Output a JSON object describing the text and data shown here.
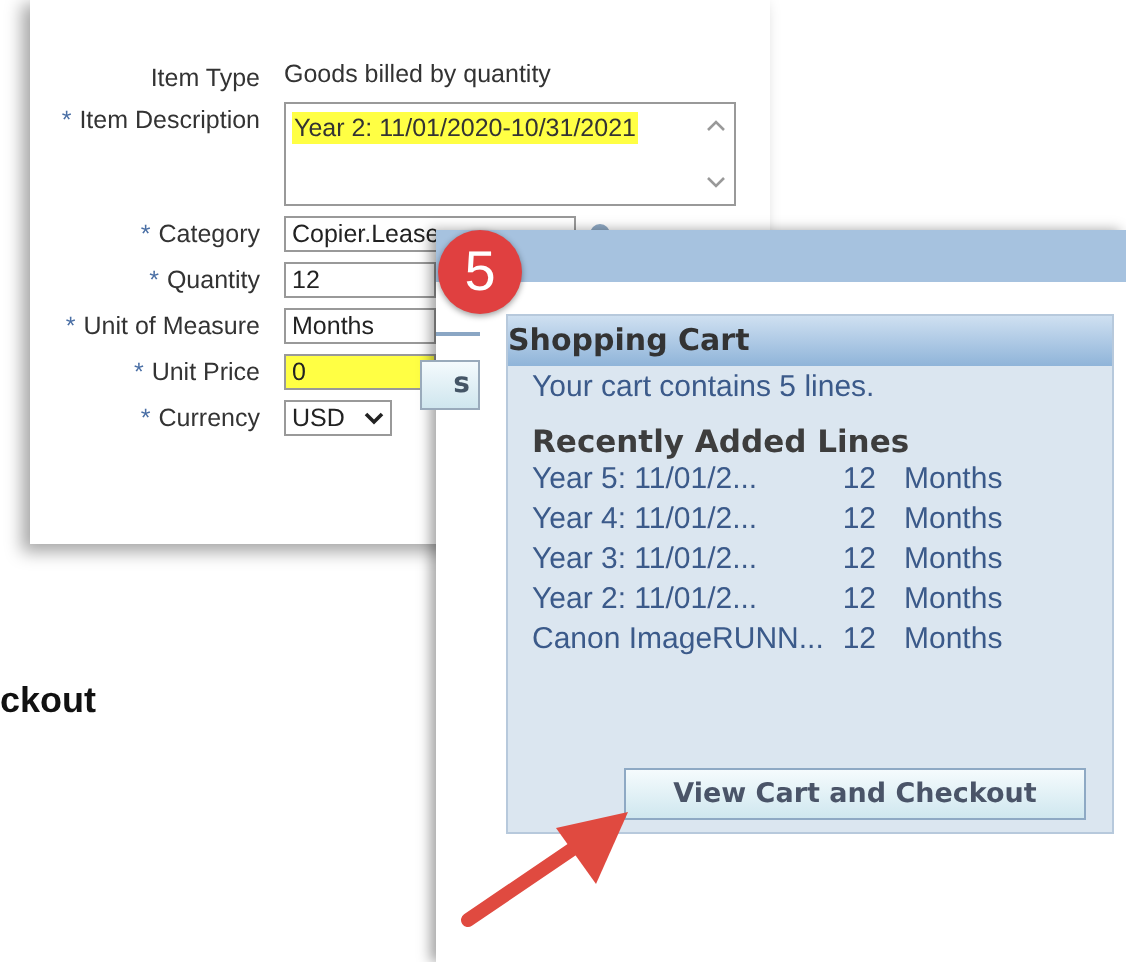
{
  "form": {
    "fields": [
      {
        "kind": "text",
        "label": "Item Type",
        "value": "Goods billed by quantity"
      },
      {
        "kind": "textarea",
        "mark": "*",
        "label": "Item Description",
        "value": "Year 2: 11/01/2020-10/31/2021",
        "highlighted": true
      },
      {
        "kind": "lookup",
        "mark": "*",
        "label": "Category",
        "value": "Copier.Lease"
      },
      {
        "kind": "input",
        "mark": "*",
        "label": "Quantity",
        "value": "12",
        "highlighted": false
      },
      {
        "kind": "input",
        "mark": "*",
        "label": "Unit of Measure",
        "value": "Months",
        "highlighted": false
      },
      {
        "kind": "input",
        "mark": "*",
        "label": "Unit Price",
        "value": "0",
        "highlighted": true
      },
      {
        "kind": "select",
        "mark": "*",
        "label": "Currency",
        "value": "USD"
      }
    ]
  },
  "document_text": "ckout",
  "popup": {
    "step_badge": "5",
    "partial_button": "s",
    "cart": {
      "title": "Shopping Cart",
      "summary": "Your cart contains 5 lines.",
      "section_title": "Recently Added Lines",
      "lines": [
        {
          "description": "Year 5: 11/01/2...",
          "quantity": "12",
          "unit": "Months"
        },
        {
          "description": "Year 4: 11/01/2...",
          "quantity": "12",
          "unit": "Months"
        },
        {
          "description": "Year 3: 11/01/2...",
          "quantity": "12",
          "unit": "Months"
        },
        {
          "description": "Year 2: 11/01/2...",
          "quantity": "12",
          "unit": "Months"
        },
        {
          "description": "Canon ImageRUNN...",
          "quantity": "12",
          "unit": "Months"
        }
      ],
      "button": "View Cart and Checkout"
    }
  }
}
